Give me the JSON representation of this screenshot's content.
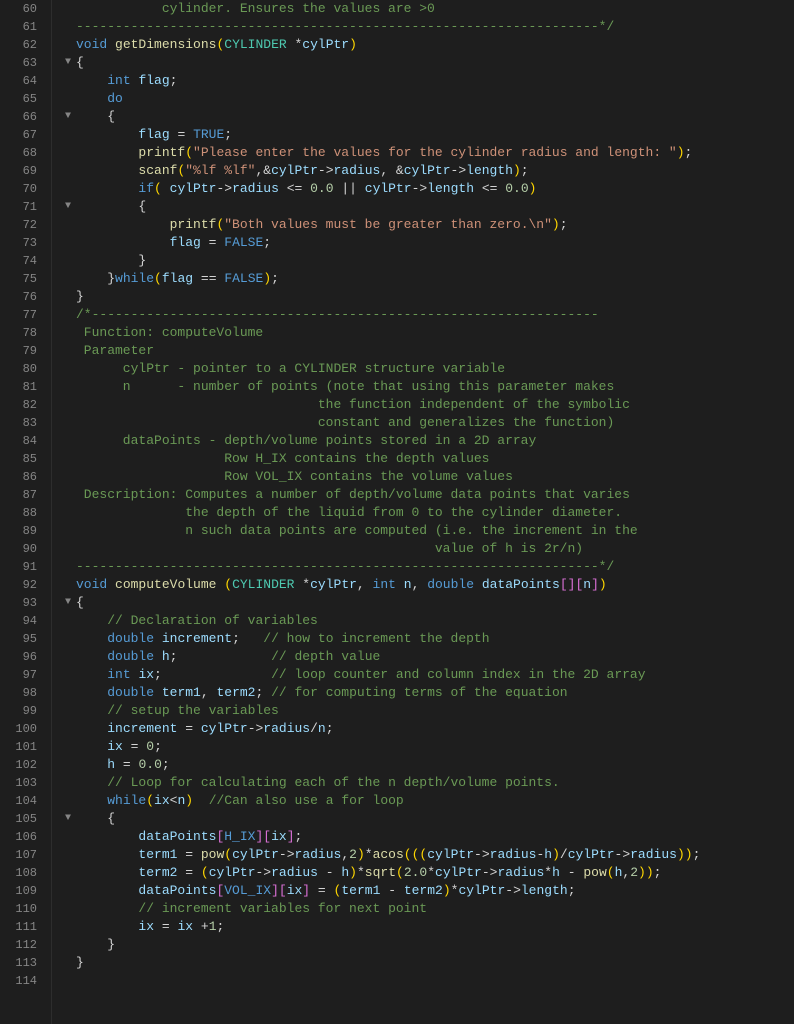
{
  "lines": [
    {
      "num": 60,
      "indent": 0,
      "fold": "",
      "html": "<span class='comment'>           cylinder. Ensures the values are &gt;0</span>"
    },
    {
      "num": 61,
      "indent": 0,
      "fold": "",
      "html": "<span class='comment'>-------------------------------------------------------------------*/</span>"
    },
    {
      "num": 62,
      "indent": 0,
      "fold": "",
      "html": "<span class='kw'>void</span> <span class='fn'>getDimensions</span><span class='paren'>(</span><span class='type'>CYLINDER</span> *<span class='param'>cylPtr</span><span class='paren'>)</span>"
    },
    {
      "num": 63,
      "indent": 0,
      "fold": "▼",
      "html": "<span class='plain'>{</span>"
    },
    {
      "num": 64,
      "indent": 1,
      "fold": "",
      "html": "    <span class='kw'>int</span> <span class='param'>flag</span><span class='plain'>;</span>"
    },
    {
      "num": 65,
      "indent": 1,
      "fold": "",
      "html": "    <span class='kw'>do</span>"
    },
    {
      "num": 66,
      "indent": 1,
      "fold": "▼",
      "html": "    <span class='plain'>{</span>"
    },
    {
      "num": 67,
      "indent": 2,
      "fold": "",
      "html": "        <span class='param'>flag</span> <span class='op'>=</span> <span class='macro'>TRUE</span><span class='plain'>;</span>"
    },
    {
      "num": 68,
      "indent": 2,
      "fold": "",
      "html": "        <span class='fn'>printf</span><span class='paren'>(</span><span class='str'>\"Please enter the values for the cylinder radius and length: \"</span><span class='paren'>)</span><span class='plain'>;</span>"
    },
    {
      "num": 69,
      "indent": 2,
      "fold": "",
      "html": "        <span class='fn'>scanf</span><span class='paren'>(</span><span class='str'>\"%lf %lf\"</span><span class='plain'>,&amp;</span><span class='param'>cylPtr</span><span class='arrow'>-&gt;</span><span class='param'>radius</span><span class='plain'>, &amp;</span><span class='param'>cylPtr</span><span class='arrow'>-&gt;</span><span class='param'>length</span><span class='paren'>)</span><span class='plain'>;</span>"
    },
    {
      "num": 70,
      "indent": 2,
      "fold": "",
      "html": "        <span class='kw'>if</span><span class='paren'>(</span> <span class='param'>cylPtr</span><span class='arrow'>-&gt;</span><span class='param'>radius</span> <span class='op'>&lt;=</span> <span class='num'>0.0</span> <span class='op'>||</span> <span class='param'>cylPtr</span><span class='arrow'>-&gt;</span><span class='param'>length</span> <span class='op'>&lt;=</span> <span class='num'>0.0</span><span class='paren'>)</span>"
    },
    {
      "num": 71,
      "indent": 2,
      "fold": "▼",
      "html": "        <span class='plain'>{</span>"
    },
    {
      "num": 72,
      "indent": 3,
      "fold": "",
      "html": "            <span class='fn'>printf</span><span class='paren'>(</span><span class='str'>\"Both values must be greater than zero.\\n\"</span><span class='paren'>)</span><span class='plain'>;</span>"
    },
    {
      "num": 73,
      "indent": 3,
      "fold": "",
      "html": "            <span class='param'>flag</span> <span class='op'>=</span> <span class='macro'>FALSE</span><span class='plain'>;</span>"
    },
    {
      "num": 74,
      "indent": 2,
      "fold": "",
      "html": "        <span class='plain'>}</span>"
    },
    {
      "num": 75,
      "indent": 1,
      "fold": "",
      "html": "    <span class='plain'>}</span><span class='kw'>while</span><span class='paren'>(</span><span class='param'>flag</span> <span class='op'>==</span> <span class='macro'>FALSE</span><span class='paren'>)</span><span class='plain'>;</span>"
    },
    {
      "num": 76,
      "indent": 0,
      "fold": "",
      "html": "<span class='plain'>}</span>"
    },
    {
      "num": 77,
      "indent": 0,
      "fold": "",
      "html": "<span class='comment'>/*-----------------------------------------------------------------</span>"
    },
    {
      "num": 78,
      "indent": 0,
      "fold": "",
      "html": "<span class='comment'> Function: computeVolume</span>"
    },
    {
      "num": 79,
      "indent": 0,
      "fold": "",
      "html": "<span class='comment'> Parameter</span>"
    },
    {
      "num": 80,
      "indent": 0,
      "fold": "",
      "html": "<span class='comment'>      cylPtr - pointer to a CYLINDER structure variable</span>"
    },
    {
      "num": 81,
      "indent": 0,
      "fold": "",
      "html": "<span class='comment'>      n      - number of points (note that using this parameter makes</span>"
    },
    {
      "num": 82,
      "indent": 0,
      "fold": "",
      "html": "<span class='comment'>                               the function independent of the symbolic</span>"
    },
    {
      "num": 83,
      "indent": 0,
      "fold": "",
      "html": "<span class='comment'>                               constant and generalizes the function)</span>"
    },
    {
      "num": 84,
      "indent": 0,
      "fold": "",
      "html": "<span class='comment'>      dataPoints - depth/volume points stored in a 2D array</span>"
    },
    {
      "num": 85,
      "indent": 0,
      "fold": "",
      "html": "<span class='comment'>                   Row H_IX contains the depth values</span>"
    },
    {
      "num": 86,
      "indent": 0,
      "fold": "",
      "html": "<span class='comment'>                   Row VOL_IX contains the volume values</span>"
    },
    {
      "num": 87,
      "indent": 0,
      "fold": "",
      "html": "<span class='comment'> Description: Computes a number of depth/volume data points that varies</span>"
    },
    {
      "num": 88,
      "indent": 0,
      "fold": "",
      "html": "<span class='comment'>              the depth of the liquid from 0 to the cylinder diameter.</span>"
    },
    {
      "num": 89,
      "indent": 0,
      "fold": "",
      "html": "<span class='comment'>              n such data points are computed (i.e. the increment in the</span>"
    },
    {
      "num": 90,
      "indent": 0,
      "fold": "",
      "html": "<span class='comment'>                                              value of h is 2r/n)</span>"
    },
    {
      "num": 91,
      "indent": 0,
      "fold": "",
      "html": "<span class='comment'>-------------------------------------------------------------------*/</span>"
    },
    {
      "num": 92,
      "indent": 0,
      "fold": "",
      "html": "<span class='kw'>void</span> <span class='fn'>computeVolume</span> <span class='paren'>(</span><span class='type'>CYLINDER</span> *<span class='param'>cylPtr</span><span class='plain'>,</span> <span class='kw'>int</span> <span class='param'>n</span><span class='plain'>,</span> <span class='kw'>double</span> <span class='param'>dataPoints</span><span class='bracket'>[</span><span class='bracket'>]</span><span class='bracket'>[</span><span class='param'>n</span><span class='bracket'>]</span><span class='paren'>)</span>"
    },
    {
      "num": 93,
      "indent": 0,
      "fold": "▼",
      "html": "<span class='plain'>{</span>"
    },
    {
      "num": 94,
      "indent": 1,
      "fold": "",
      "html": "    <span class='comment'>// Declaration of variables</span>"
    },
    {
      "num": 95,
      "indent": 1,
      "fold": "",
      "html": "    <span class='kw'>double</span> <span class='param'>increment</span><span class='plain'>;   </span><span class='comment'>// how to increment the depth</span>"
    },
    {
      "num": 96,
      "indent": 1,
      "fold": "",
      "html": "    <span class='kw'>double</span> <span class='param'>h</span><span class='plain'>;            </span><span class='comment'>// depth value</span>"
    },
    {
      "num": 97,
      "indent": 1,
      "fold": "",
      "html": "    <span class='kw'>int</span> <span class='param'>ix</span><span class='plain'>;              </span><span class='comment'>// loop counter and column index in the 2D array</span>"
    },
    {
      "num": 98,
      "indent": 1,
      "fold": "",
      "html": "    <span class='kw'>double</span> <span class='param'>term1</span><span class='plain'>, </span><span class='param'>term2</span><span class='plain'>; </span><span class='comment'>// for computing terms of the equation</span>"
    },
    {
      "num": 99,
      "indent": 1,
      "fold": "",
      "html": "    <span class='comment'>// setup the variables</span>"
    },
    {
      "num": 100,
      "indent": 1,
      "fold": "",
      "html": "    <span class='param'>increment</span> <span class='op'>=</span> <span class='param'>cylPtr</span><span class='arrow'>-&gt;</span><span class='param'>radius</span><span class='op'>/</span><span class='param'>n</span><span class='plain'>;</span>"
    },
    {
      "num": 101,
      "indent": 1,
      "fold": "",
      "html": "    <span class='param'>ix</span> <span class='op'>=</span> <span class='num'>0</span><span class='plain'>;</span>"
    },
    {
      "num": 102,
      "indent": 1,
      "fold": "",
      "html": "    <span class='param'>h</span> <span class='op'>=</span> <span class='num'>0.0</span><span class='plain'>;</span>"
    },
    {
      "num": 103,
      "indent": 1,
      "fold": "",
      "html": "    <span class='comment'>// Loop for calculating each of the n depth/volume points.</span>"
    },
    {
      "num": 104,
      "indent": 1,
      "fold": "",
      "html": "    <span class='kw'>while</span><span class='paren'>(</span><span class='param'>ix</span><span class='op'>&lt;</span><span class='param'>n</span><span class='paren'>)</span>  <span class='comment'>//Can also use a for loop</span>"
    },
    {
      "num": 105,
      "indent": 1,
      "fold": "▼",
      "html": "    <span class='plain'>{</span>"
    },
    {
      "num": 106,
      "indent": 2,
      "fold": "",
      "html": "        <span class='param'>dataPoints</span><span class='bracket'>[</span><span class='macro'>H_IX</span><span class='bracket'>]</span><span class='bracket'>[</span><span class='param'>ix</span><span class='bracket'>]</span><span class='plain'>;</span>"
    },
    {
      "num": 107,
      "indent": 2,
      "fold": "",
      "html": "        <span class='param'>term1</span> <span class='op'>=</span> <span class='fn'>pow</span><span class='paren'>(</span><span class='param'>cylPtr</span><span class='arrow'>-&gt;</span><span class='param'>radius</span><span class='plain'>,</span><span class='num'>2</span><span class='paren'>)</span><span class='op'>*</span><span class='fn'>acos</span><span class='paren'>((</span><span class='paren'>(</span><span class='param'>cylPtr</span><span class='arrow'>-&gt;</span><span class='param'>radius</span><span class='op'>-</span><span class='param'>h</span><span class='paren'>)</span><span class='op'>/</span><span class='param'>cylPtr</span><span class='arrow'>-&gt;</span><span class='param'>radius</span><span class='paren'>)</span><span class='paren'>)</span><span class='plain'>;</span>"
    },
    {
      "num": 108,
      "indent": 2,
      "fold": "",
      "html": "        <span class='param'>term2</span> <span class='op'>=</span> <span class='paren'>(</span><span class='param'>cylPtr</span><span class='arrow'>-&gt;</span><span class='param'>radius</span> <span class='op'>-</span> <span class='param'>h</span><span class='paren'>)</span><span class='op'>*</span><span class='fn'>sqrt</span><span class='paren'>(</span><span class='num'>2.0</span><span class='op'>*</span><span class='param'>cylPtr</span><span class='arrow'>-&gt;</span><span class='param'>radius</span><span class='op'>*</span><span class='param'>h</span> <span class='op'>-</span> <span class='fn'>pow</span><span class='paren'>(</span><span class='param'>h</span><span class='plain'>,</span><span class='num'>2</span><span class='paren'>)</span><span class='paren'>)</span><span class='plain'>;</span>"
    },
    {
      "num": 109,
      "indent": 2,
      "fold": "",
      "html": "        <span class='param'>dataPoints</span><span class='bracket'>[</span><span class='macro'>VOL_IX</span><span class='bracket'>]</span><span class='bracket'>[</span><span class='param'>ix</span><span class='bracket'>]</span> <span class='op'>=</span> <span class='paren'>(</span><span class='param'>term1</span> <span class='op'>-</span> <span class='param'>term2</span><span class='paren'>)</span><span class='op'>*</span><span class='param'>cylPtr</span><span class='arrow'>-&gt;</span><span class='param'>length</span><span class='plain'>;</span>"
    },
    {
      "num": 110,
      "indent": 2,
      "fold": "",
      "html": "        <span class='comment'>// increment variables for next point</span>"
    },
    {
      "num": 111,
      "indent": 2,
      "fold": "",
      "html": "        <span class='param'>ix</span> <span class='op'>=</span> <span class='param'>ix</span> <span class='op'>+</span><span class='num'>1</span><span class='plain'>;</span>"
    },
    {
      "num": 112,
      "indent": 1,
      "fold": "",
      "html": "    <span class='plain'>}</span>"
    },
    {
      "num": 113,
      "indent": 0,
      "fold": "",
      "html": "<span class='plain'>}</span>"
    },
    {
      "num": 114,
      "indent": 0,
      "fold": "",
      "html": ""
    }
  ]
}
